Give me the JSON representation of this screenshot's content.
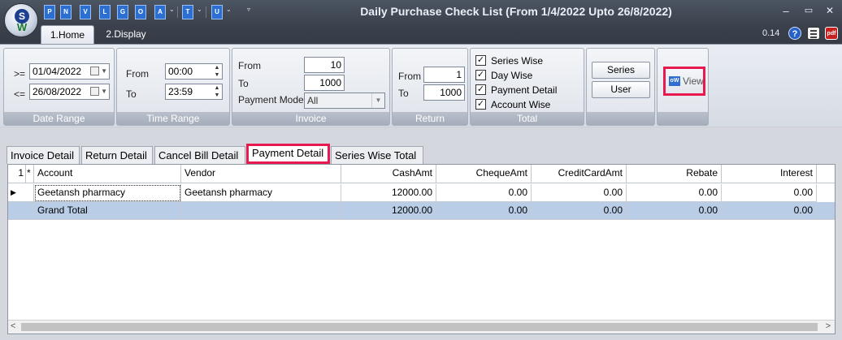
{
  "titlebar": {
    "title": "Daily Purchase Check List (From 1/4/2022 Upto 26/8/2022)",
    "quick_access": [
      "P",
      "N",
      "V",
      "L",
      "G",
      "O",
      "A",
      "T",
      "U"
    ],
    "minimize": "–",
    "restore": "▭",
    "close": "✕",
    "tabs": {
      "home": "1.Home",
      "display": "2.Display"
    },
    "zoom": "0.14",
    "help": "?",
    "pdf": "pdf"
  },
  "ribbon": {
    "date_range": {
      "caption": "Date Range",
      "from_op": ">=",
      "from_value": "01/04/2022",
      "to_op": "<=",
      "to_value": "26/08/2022"
    },
    "time_range": {
      "caption": "Time Range",
      "from_label": "From",
      "from_value": "00:00",
      "to_label": "To",
      "to_value": "23:59"
    },
    "invoice": {
      "caption": "Invoice",
      "from_label": "From",
      "from_value": "10",
      "to_label": "To",
      "to_value": "1000",
      "payment_mode_label": "Payment Mode",
      "payment_mode_value": "All"
    },
    "return": {
      "caption": "Return",
      "from_label": "From",
      "from_value": "1",
      "to_label": "To",
      "to_value": "1000"
    },
    "total": {
      "caption": "Total",
      "options": [
        {
          "label": "Series Wise",
          "checked": true
        },
        {
          "label": "Day Wise",
          "checked": true
        },
        {
          "label": "Payment Detail",
          "checked": true
        },
        {
          "label": "Account Wise",
          "checked": true
        }
      ]
    },
    "buttons": {
      "series": "Series",
      "user": "User",
      "view": "View",
      "view_icon": "oW"
    }
  },
  "tabs": [
    "Invoice Detail",
    "Return Detail",
    "Cancel Bill Detail",
    "Payment Detail",
    "Series Wise Total"
  ],
  "active_tab": "Payment Detail",
  "grid": {
    "corner": [
      "1",
      "*"
    ],
    "columns": [
      "Account",
      "Vendor",
      "CashAmt",
      "ChequeAmt",
      "CreditCardAmt",
      "Rebate",
      "Interest"
    ],
    "rows": [
      {
        "indicator": "▶",
        "cells": [
          "Geetansh pharmacy",
          "Geetansh pharmacy",
          "12000.00",
          "0.00",
          "0.00",
          "0.00",
          "0.00"
        ]
      }
    ],
    "total": {
      "cells": [
        "Grand Total",
        "",
        "12000.00",
        "0.00",
        "0.00",
        "0.00",
        "0.00"
      ]
    }
  }
}
